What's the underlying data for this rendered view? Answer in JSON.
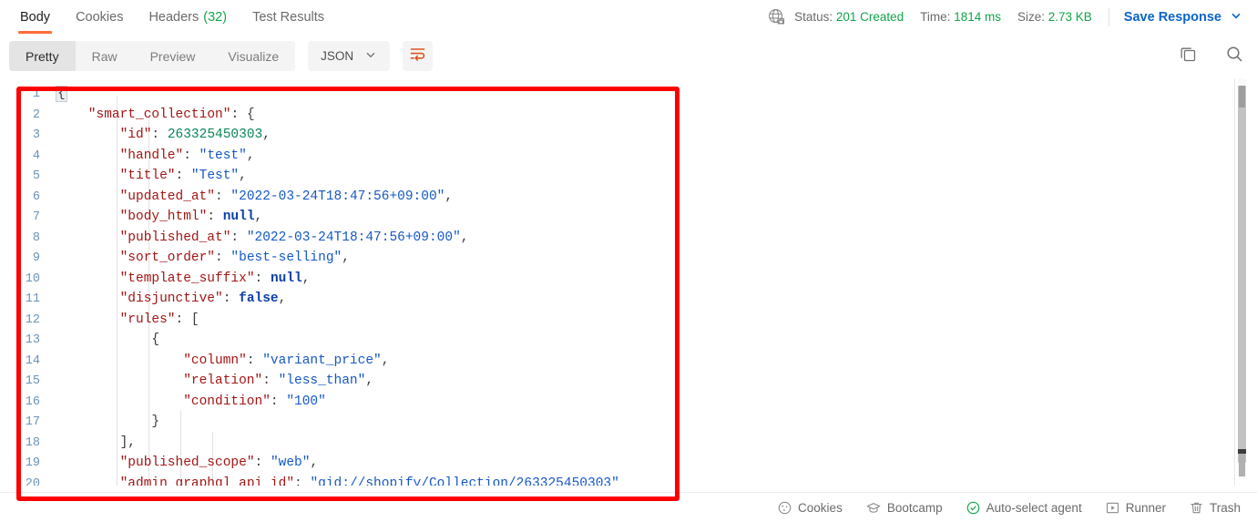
{
  "response_tabs": [
    {
      "label": "Body",
      "active": true,
      "count": null
    },
    {
      "label": "Cookies",
      "active": false,
      "count": null
    },
    {
      "label": "Headers",
      "active": false,
      "count": "(32)"
    },
    {
      "label": "Test Results",
      "active": false,
      "count": null
    }
  ],
  "meta": {
    "security_icon": "globe-lock-icon",
    "status_label": "Status:",
    "status_value": "201 Created",
    "time_label": "Time:",
    "time_value": "1814 ms",
    "size_label": "Size:",
    "size_value": "2.73 KB",
    "save_response_label": "Save Response",
    "save_response_chevron": "chevron-down-icon"
  },
  "format_bar": {
    "modes": [
      {
        "label": "Pretty",
        "active": true
      },
      {
        "label": "Raw",
        "active": false
      },
      {
        "label": "Preview",
        "active": false
      },
      {
        "label": "Visualize",
        "active": false
      }
    ],
    "language": "JSON",
    "language_chevron": "chevron-down-icon",
    "wrap_button": "word-wrap-icon",
    "copy_button": "copy-icon",
    "search_button": "search-icon"
  },
  "code": {
    "language": "json",
    "lines": [
      {
        "no": "1",
        "tokens": [
          {
            "t": "brace-match",
            "v": "{"
          }
        ]
      },
      {
        "no": "2",
        "indent": 4,
        "tokens": [
          {
            "t": "k",
            "v": "\"smart_collection\""
          },
          {
            "t": "p",
            "v": ": "
          },
          {
            "t": "br",
            "v": "{"
          }
        ]
      },
      {
        "no": "3",
        "indent": 8,
        "tokens": [
          {
            "t": "k",
            "v": "\"id\""
          },
          {
            "t": "p",
            "v": ": "
          },
          {
            "t": "n",
            "v": "263325450303"
          },
          {
            "t": "p",
            "v": ","
          }
        ]
      },
      {
        "no": "4",
        "indent": 8,
        "tokens": [
          {
            "t": "k",
            "v": "\"handle\""
          },
          {
            "t": "p",
            "v": ": "
          },
          {
            "t": "s",
            "v": "\"test\""
          },
          {
            "t": "p",
            "v": ","
          }
        ]
      },
      {
        "no": "5",
        "indent": 8,
        "tokens": [
          {
            "t": "k",
            "v": "\"title\""
          },
          {
            "t": "p",
            "v": ": "
          },
          {
            "t": "s",
            "v": "\"Test\""
          },
          {
            "t": "p",
            "v": ","
          }
        ]
      },
      {
        "no": "6",
        "indent": 8,
        "tokens": [
          {
            "t": "k",
            "v": "\"updated_at\""
          },
          {
            "t": "p",
            "v": ": "
          },
          {
            "t": "s",
            "v": "\"2022-03-24T18:47:56+09:00\""
          },
          {
            "t": "p",
            "v": ","
          }
        ]
      },
      {
        "no": "7",
        "indent": 8,
        "tokens": [
          {
            "t": "k",
            "v": "\"body_html\""
          },
          {
            "t": "p",
            "v": ": "
          },
          {
            "t": "lit",
            "v": "null"
          },
          {
            "t": "p",
            "v": ","
          }
        ]
      },
      {
        "no": "8",
        "indent": 8,
        "tokens": [
          {
            "t": "k",
            "v": "\"published_at\""
          },
          {
            "t": "p",
            "v": ": "
          },
          {
            "t": "s",
            "v": "\"2022-03-24T18:47:56+09:00\""
          },
          {
            "t": "p",
            "v": ","
          }
        ]
      },
      {
        "no": "9",
        "indent": 8,
        "tokens": [
          {
            "t": "k",
            "v": "\"sort_order\""
          },
          {
            "t": "p",
            "v": ": "
          },
          {
            "t": "s",
            "v": "\"best-selling\""
          },
          {
            "t": "p",
            "v": ","
          }
        ]
      },
      {
        "no": "10",
        "indent": 8,
        "tokens": [
          {
            "t": "k",
            "v": "\"template_suffix\""
          },
          {
            "t": "p",
            "v": ": "
          },
          {
            "t": "lit",
            "v": "null"
          },
          {
            "t": "p",
            "v": ","
          }
        ]
      },
      {
        "no": "11",
        "indent": 8,
        "tokens": [
          {
            "t": "k",
            "v": "\"disjunctive\""
          },
          {
            "t": "p",
            "v": ": "
          },
          {
            "t": "lit",
            "v": "false"
          },
          {
            "t": "p",
            "v": ","
          }
        ]
      },
      {
        "no": "12",
        "indent": 8,
        "tokens": [
          {
            "t": "k",
            "v": "\"rules\""
          },
          {
            "t": "p",
            "v": ": "
          },
          {
            "t": "br",
            "v": "["
          }
        ]
      },
      {
        "no": "13",
        "indent": 12,
        "tokens": [
          {
            "t": "br",
            "v": "{"
          }
        ]
      },
      {
        "no": "14",
        "indent": 16,
        "tokens": [
          {
            "t": "k",
            "v": "\"column\""
          },
          {
            "t": "p",
            "v": ": "
          },
          {
            "t": "s",
            "v": "\"variant_price\""
          },
          {
            "t": "p",
            "v": ","
          }
        ]
      },
      {
        "no": "15",
        "indent": 16,
        "tokens": [
          {
            "t": "k",
            "v": "\"relation\""
          },
          {
            "t": "p",
            "v": ": "
          },
          {
            "t": "s",
            "v": "\"less_than\""
          },
          {
            "t": "p",
            "v": ","
          }
        ]
      },
      {
        "no": "16",
        "indent": 16,
        "tokens": [
          {
            "t": "k",
            "v": "\"condition\""
          },
          {
            "t": "p",
            "v": ": "
          },
          {
            "t": "s",
            "v": "\"100\""
          }
        ]
      },
      {
        "no": "17",
        "indent": 12,
        "tokens": [
          {
            "t": "br",
            "v": "}"
          }
        ]
      },
      {
        "no": "18",
        "indent": 8,
        "tokens": [
          {
            "t": "br",
            "v": "]"
          },
          {
            "t": "p",
            "v": ","
          }
        ]
      },
      {
        "no": "19",
        "indent": 8,
        "tokens": [
          {
            "t": "k",
            "v": "\"published_scope\""
          },
          {
            "t": "p",
            "v": ": "
          },
          {
            "t": "s",
            "v": "\"web\""
          },
          {
            "t": "p",
            "v": ","
          }
        ]
      },
      {
        "no": "20",
        "indent": 8,
        "tokens": [
          {
            "t": "k",
            "v": "\"admin_graphql_api_id\""
          },
          {
            "t": "p",
            "v": ": "
          },
          {
            "t": "s",
            "v": "\"gid://shopify/Collection/263325450303\""
          }
        ]
      }
    ]
  },
  "annotation": {
    "shape": "rectangle",
    "color": "#ff0000"
  },
  "footer": {
    "items": [
      {
        "label": "Cookies",
        "icon": "cookie-icon"
      },
      {
        "label": "Bootcamp",
        "icon": "graduation-cap-icon"
      },
      {
        "label": "Auto-select agent",
        "icon": "check-circle-icon"
      },
      {
        "label": "Runner",
        "icon": "play-box-icon"
      },
      {
        "label": "Trash",
        "icon": "trash-icon"
      }
    ]
  },
  "colors": {
    "accent_orange": "#ff6c37",
    "status_green": "#10a54a",
    "link_blue": "#0b64c8",
    "annotation_red": "#ff0000"
  }
}
